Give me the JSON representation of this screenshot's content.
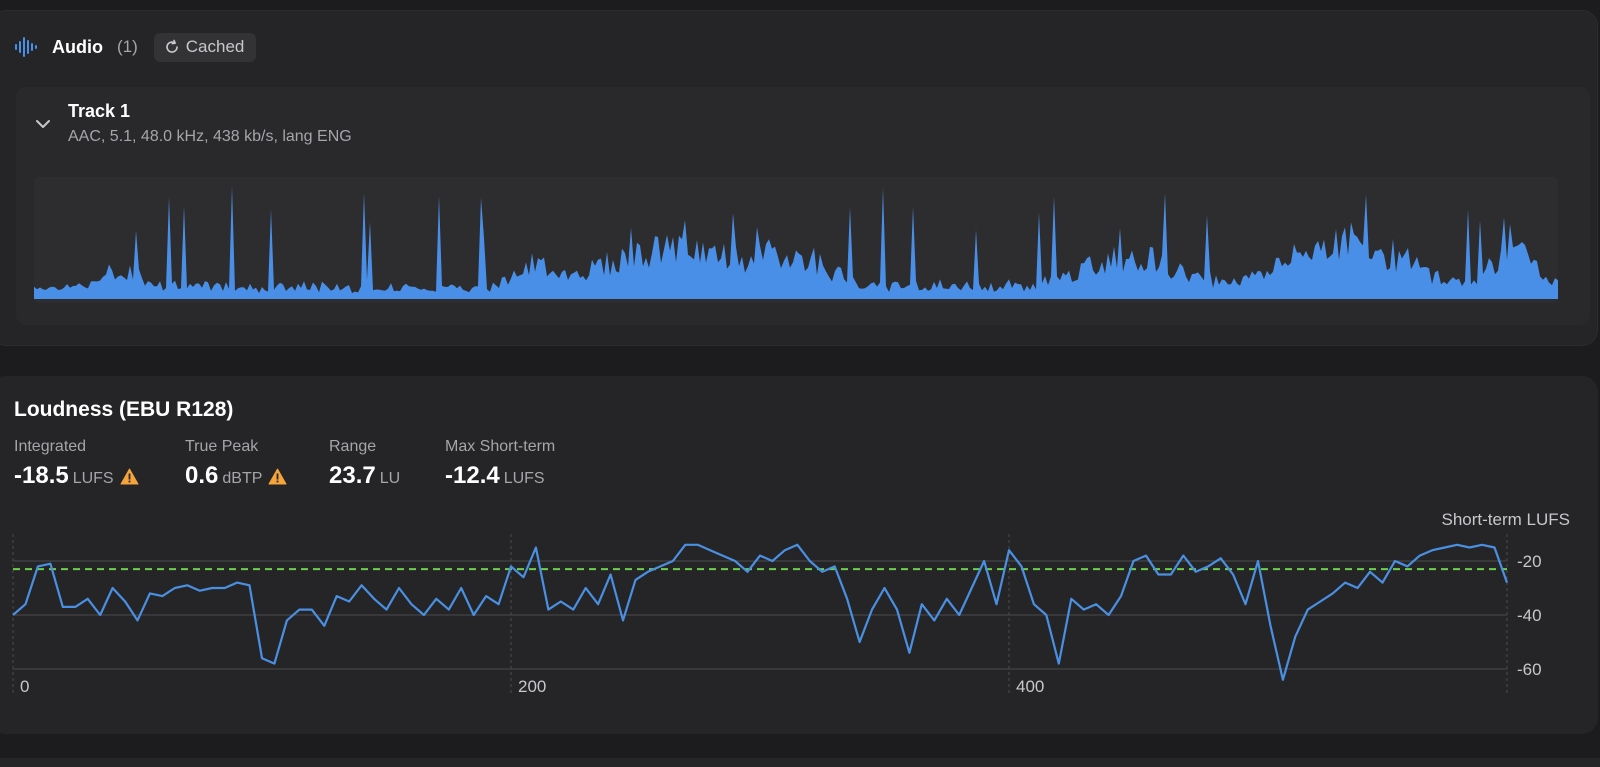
{
  "audio": {
    "title": "Audio",
    "count": "(1)",
    "cached_label": "Cached",
    "accent": "#4a8fe7"
  },
  "track": {
    "title": "Track 1",
    "meta": "AAC, 5.1, 48.0 kHz, 438 kb/s, lang ENG"
  },
  "loudness": {
    "title": "Loudness (EBU R128)",
    "metrics": [
      {
        "label": "Integrated",
        "value": "-18.5",
        "unit": "LUFS",
        "warning": true
      },
      {
        "label": "True Peak",
        "value": "0.6",
        "unit": "dBTP",
        "warning": true
      },
      {
        "label": "Range",
        "value": "23.7",
        "unit": "LU",
        "warning": false
      },
      {
        "label": "Max Short-term",
        "value": "-12.4",
        "unit": "LUFS",
        "warning": false
      }
    ],
    "warning_color": "#f5a33b"
  },
  "chart_data": {
    "type": "line",
    "legend": "Short-term LUFS",
    "series_color": "#4a90e2",
    "target_line": -23,
    "target_color": "#6bd14b",
    "xlim": [
      0,
      600
    ],
    "ylim": [
      -70,
      -10
    ],
    "x_ticks": [
      0,
      200,
      400
    ],
    "y_ticks": [
      -20,
      -40,
      -60
    ],
    "x": [
      0,
      5,
      10,
      15,
      20,
      25,
      30,
      35,
      40,
      45,
      50,
      55,
      60,
      65,
      70,
      75,
      80,
      85,
      90,
      95,
      100,
      105,
      110,
      115,
      120,
      125,
      130,
      135,
      140,
      145,
      150,
      155,
      160,
      165,
      170,
      175,
      180,
      185,
      190,
      195,
      200,
      205,
      210,
      215,
      220,
      225,
      230,
      235,
      240,
      245,
      250,
      255,
      260,
      265,
      270,
      275,
      280,
      285,
      290,
      295,
      300,
      305,
      310,
      315,
      320,
      325,
      330,
      335,
      340,
      345,
      350,
      355,
      360,
      365,
      370,
      375,
      380,
      385,
      390,
      395,
      400,
      405,
      410,
      415,
      420,
      425,
      430,
      435,
      440,
      445,
      450,
      455,
      460,
      465,
      470,
      475,
      480,
      485,
      490,
      495,
      500,
      505,
      510,
      515,
      520,
      525,
      530,
      535,
      540,
      545,
      550,
      555,
      560,
      565,
      570,
      575,
      580,
      585,
      590,
      595,
      600
    ],
    "y": [
      -40,
      -36,
      -22,
      -21,
      -37,
      -37,
      -34,
      -40,
      -30,
      -35,
      -42,
      -32,
      -33,
      -30,
      -29,
      -31,
      -30,
      -30,
      -28,
      -29,
      -56,
      -58,
      -42,
      -38,
      -38,
      -44,
      -33,
      -35,
      -29,
      -34,
      -38,
      -30,
      -36,
      -40,
      -34,
      -38,
      -30,
      -40,
      -33,
      -36,
      -22,
      -26,
      -15,
      -38,
      -35,
      -38,
      -30,
      -36,
      -25,
      -42,
      -27,
      -24,
      -22,
      -20,
      -14,
      -14,
      -16,
      -18,
      -20,
      -24,
      -18,
      -20,
      -16,
      -14,
      -20,
      -24,
      -22,
      -34,
      -50,
      -38,
      -30,
      -38,
      -54,
      -36,
      -42,
      -34,
      -40,
      -30,
      -20,
      -36,
      -16,
      -22,
      -36,
      -40,
      -58,
      -34,
      -38,
      -36,
      -40,
      -33,
      -20,
      -18,
      -25,
      -25,
      -18,
      -24,
      -22,
      -19,
      -25,
      -36,
      -20,
      -44,
      -64,
      -48,
      -38,
      -35,
      -32,
      -28,
      -30,
      -24,
      -28,
      -20,
      -22,
      -18,
      -16,
      -15,
      -14,
      -15,
      -14,
      -15,
      -28
    ]
  }
}
